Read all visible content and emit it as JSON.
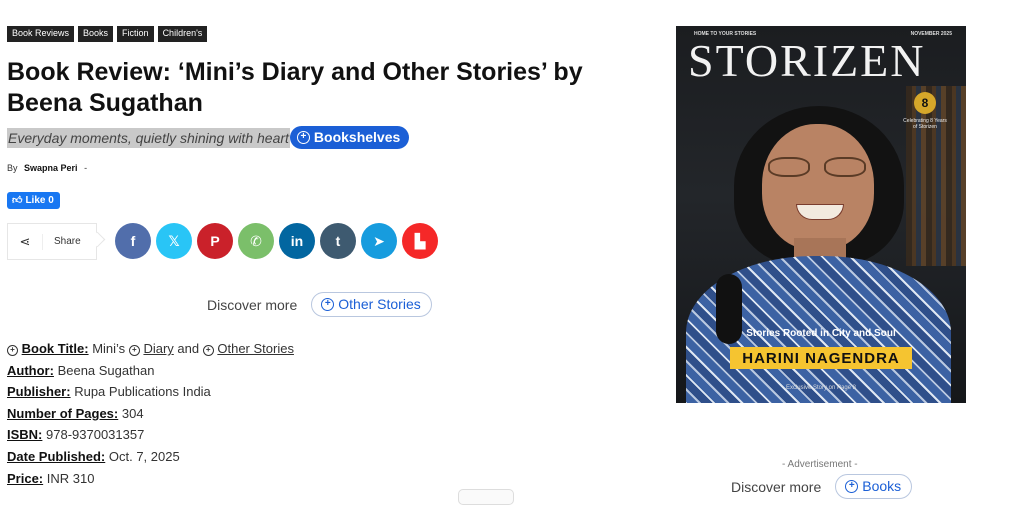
{
  "categories": [
    "Book Reviews",
    "Books",
    "Fiction",
    "Children's"
  ],
  "article": {
    "title": "Book Review: ‘Mini’s Diary and Other Stories’ by Beena Sugathan",
    "subtitle": "Everyday moments, quietly shining with heart",
    "subtitle_link": "Bookshelves",
    "by_label": "By",
    "author": "Swapna Peri",
    "dash": "-"
  },
  "like": {
    "label": "Like 0"
  },
  "share": {
    "label": "Share"
  },
  "social": [
    {
      "name": "facebook-icon",
      "glyph": "f",
      "color": "#3b5998"
    },
    {
      "name": "x-icon",
      "glyph": "𝕏",
      "color": "#1da1f2"
    },
    {
      "name": "pinterest-icon",
      "glyph": "P",
      "color": "#cb2027"
    },
    {
      "name": "whatsapp-icon",
      "glyph": "✆",
      "color": "#5cbe4a"
    },
    {
      "name": "linkedin-icon",
      "glyph": "in",
      "color": "#0077b5"
    },
    {
      "name": "tumblr-icon",
      "glyph": "t",
      "color": "#3e5a70"
    },
    {
      "name": "telegram-icon",
      "glyph": "➤",
      "color": "#179cde"
    },
    {
      "name": "flipboard-icon",
      "glyph": "▙",
      "color": "#f52828"
    }
  ],
  "discover1": {
    "label": "Discover more",
    "link": "Other Stories"
  },
  "details": {
    "book_title_label": "Book Title:",
    "book_title_1": "Mini’s",
    "book_title_2": "Diary",
    "book_title_3": "and",
    "book_title_4": "Other Stories",
    "author_label": "Author:",
    "author_value": "Beena Sugathan",
    "publisher_label": "Publisher:",
    "publisher_value": "Rupa Publications India",
    "pages_label": "Number of Pages:",
    "pages_value": "304",
    "isbn_label": "ISBN:",
    "isbn_value": "978-9370031357",
    "date_label": "Date Published:",
    "date_value": "Oct. 7, 2025",
    "price_label": "Price:",
    "price_value": "INR 310"
  },
  "magazine": {
    "tagline": "HOME TO YOUR STORIES",
    "month": "NOVEMBER 2025",
    "masthead": "STORIZEN",
    "badge": "8",
    "celebrating": "Celebrating 8 Years of Storizen",
    "cover_line": "Stories Rooted in City and Soul",
    "cover_name": "HARINI NAGENDRA",
    "exclusive": "Exclusive Story on Page 8"
  },
  "advertisement": "- Advertisement -",
  "discover2": {
    "label": "Discover more",
    "link": "Books"
  }
}
